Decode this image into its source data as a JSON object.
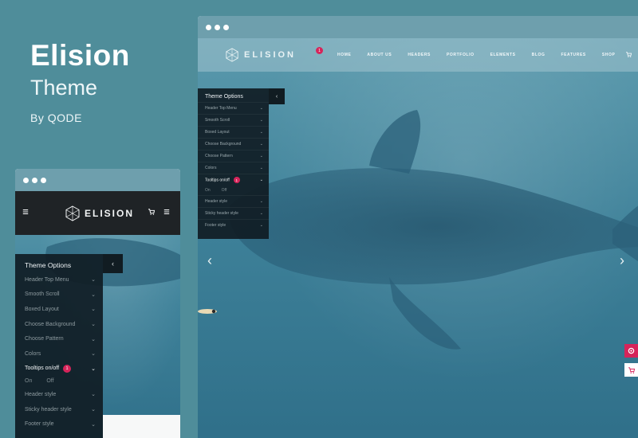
{
  "hero": {
    "title": "Elision",
    "subtitle": "Theme",
    "byline": "By QODE"
  },
  "desktop": {
    "logo_text": "ELISION",
    "nav_badge": "1",
    "nav": [
      "HOME",
      "ABOUT US",
      "HEADERS",
      "PORTFOLIO",
      "ELEMENTS",
      "BLOG",
      "FEATURES",
      "SHOP"
    ],
    "options": {
      "title": "Theme Options",
      "toggle_icon": "‹",
      "items": [
        {
          "label": "Header Top Menu"
        },
        {
          "label": "Smooth Scroll"
        },
        {
          "label": "Boxed Layout"
        },
        {
          "label": "Choose Background"
        },
        {
          "label": "Choose Pattern"
        },
        {
          "label": "Colors"
        },
        {
          "label": "Tooltips on/off",
          "badge": "1",
          "active": true
        },
        {
          "label": "Header style"
        },
        {
          "label": "Sticky header style"
        },
        {
          "label": "Footer style"
        }
      ],
      "on_label": "On",
      "off_label": "Off"
    },
    "arrows": {
      "prev": "‹",
      "next": "›"
    }
  },
  "mobile": {
    "logo_text": "ELISION",
    "options": {
      "title": "Theme Options",
      "toggle_icon": "‹",
      "items": [
        {
          "label": "Header Top Menu"
        },
        {
          "label": "Smooth Scroll"
        },
        {
          "label": "Boxed Layout"
        },
        {
          "label": "Choose Background"
        },
        {
          "label": "Choose Pattern"
        },
        {
          "label": "Colors"
        },
        {
          "label": "Tooltips on/off",
          "badge": "1",
          "active": true
        },
        {
          "label": "Header style"
        },
        {
          "label": "Sticky header style"
        },
        {
          "label": "Footer style"
        }
      ],
      "on_label": "On",
      "off_label": "Off"
    }
  },
  "colors": {
    "background": "#4f8d9a",
    "accent": "#d6245a",
    "panel": "#101c24"
  },
  "icons": {
    "menu": "hamburger-icon",
    "cart": "cart-icon",
    "chevron": "chevron-down-icon",
    "logo": "geometric-logo-icon"
  }
}
